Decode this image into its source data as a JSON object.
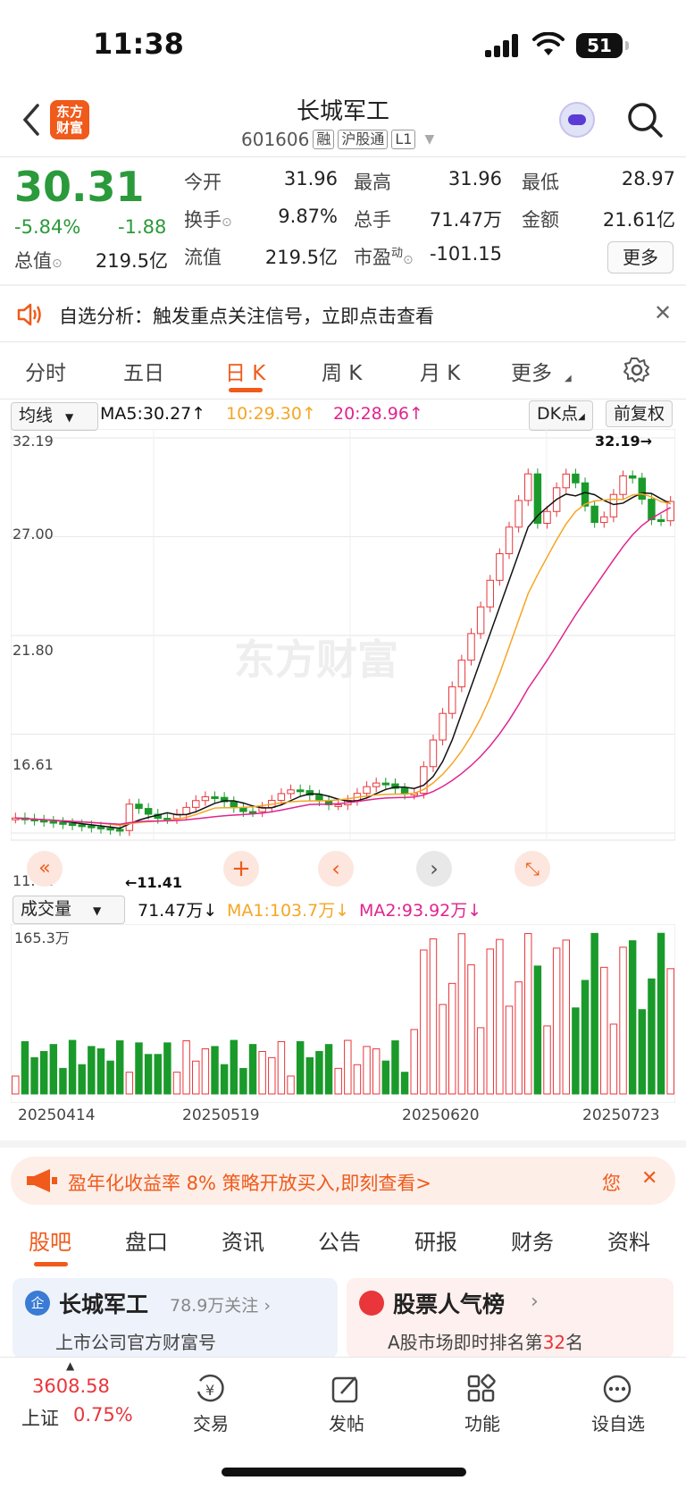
{
  "status_bar": {
    "time": "11:38",
    "battery": "51"
  },
  "header": {
    "title": "长城军工",
    "code": "601606",
    "tags": [
      "融",
      "沪股通",
      "L1"
    ],
    "logo_text": "东方财富"
  },
  "quote": {
    "price": "30.31",
    "change_pct": "-5.84%",
    "change": "-1.88",
    "rows": [
      [
        {
          "label": "今开",
          "value": "31.96",
          "color": "green"
        },
        {
          "label": "最高",
          "value": "31.96",
          "color": "green"
        },
        {
          "label": "最低",
          "value": "28.97",
          "color": "green"
        }
      ],
      [
        {
          "label": "换手",
          "value": "9.87%",
          "color": "dark"
        },
        {
          "label": "总手",
          "value": "71.47万",
          "color": "dark"
        },
        {
          "label": "金额",
          "value": "21.61亿",
          "color": "dark"
        }
      ],
      [
        {
          "label": "总值",
          "value": "219.5亿",
          "color": "dark"
        },
        {
          "label": "流值",
          "value": "219.5亿",
          "color": "dark"
        },
        {
          "label": "市盈",
          "sup": "动",
          "value": "-101.15",
          "color": "dark"
        }
      ]
    ],
    "more_label": "更多"
  },
  "notice": {
    "text": "自选分析：触发重点关注信号，立即点击查看"
  },
  "period_tabs": {
    "items": [
      "分时",
      "五日",
      "日 K",
      "周 K",
      "月 K",
      "更多"
    ],
    "active": 2
  },
  "chart_tools": {
    "indicator": "均线",
    "ma5": "MA5:30.27",
    "ma10": "10:29.30",
    "ma20": "20:28.96",
    "dk": "DK点",
    "adjust": "前复权",
    "volume_indicator": "成交量",
    "vol": "71.47万",
    "vol_ma1": "MA1:103.7万",
    "vol_ma2": "MA2:93.92万"
  },
  "chart_data": {
    "type": "candlestick",
    "y_ticks": [
      "32.19",
      "27.00",
      "21.80",
      "16.61",
      "11.41"
    ],
    "ylim": [
      11.41,
      32.19
    ],
    "max_label": "32.19",
    "min_label": "11.41",
    "volume_max_label": "165.3万",
    "x_labels": [
      "20250414",
      "20250519",
      "20250620",
      "20250723"
    ],
    "watermark": "东方财富",
    "colors": {
      "up": "#e8363b",
      "down": "#1a9a2a",
      "ma5": "#111111",
      "ma10": "#f5a623",
      "ma20": "#e0248f"
    }
  },
  "promo": {
    "text": "盈年化收益率 8% 策略开放买入,即刻查看>",
    "tail": "您"
  },
  "content_tabs": {
    "items": [
      "股吧",
      "盘口",
      "资讯",
      "公告",
      "研报",
      "财务",
      "资料"
    ],
    "active": 0
  },
  "cards": [
    {
      "title": "长城军工",
      "meta": "78.9万关注",
      "sub": "上市公司官方财富号",
      "icon": "企"
    },
    {
      "title": "股票人气榜",
      "sub_prefix": "A股市场即时排名第",
      "rank": "32",
      "sub_suffix": "名"
    }
  ],
  "bottom_bar": {
    "index_value": "3608.58",
    "index_name": "上证",
    "index_change": "0.75%",
    "items": [
      "交易",
      "发帖",
      "功能",
      "设自选"
    ]
  }
}
